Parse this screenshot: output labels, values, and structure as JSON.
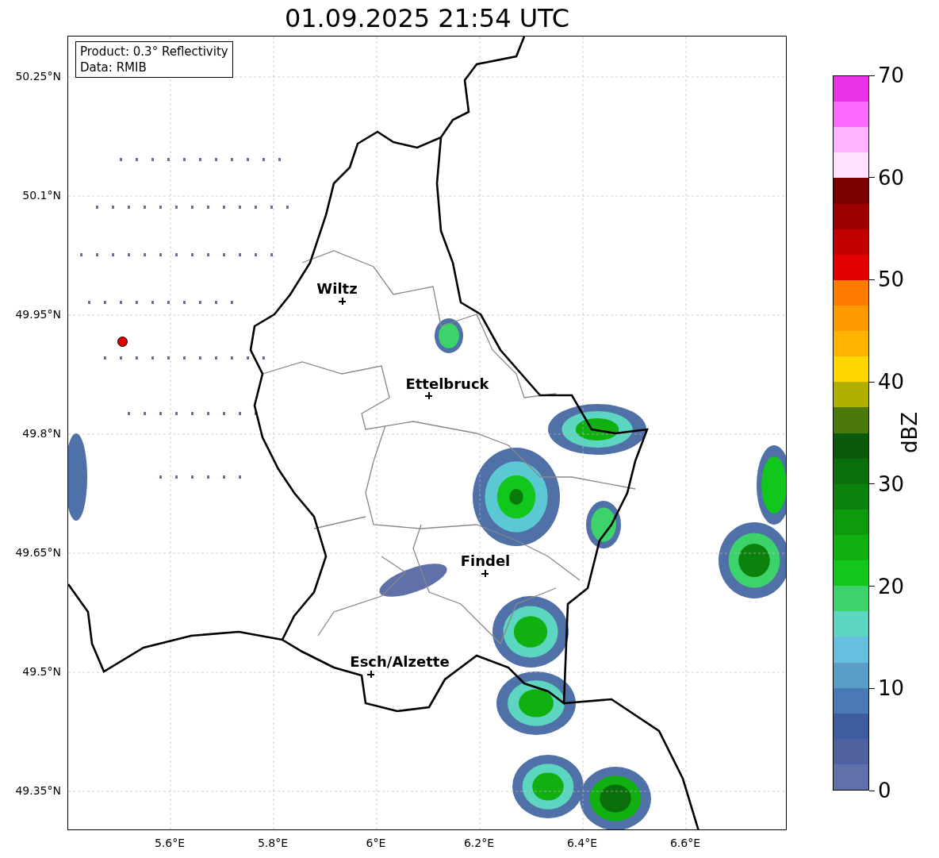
{
  "title": "01.09.2025 21:54 UTC",
  "info_box": [
    "Product: 0.3° Reflectivity",
    "Data: RMIB"
  ],
  "map": {
    "yticks": [
      "50.25°N",
      "50.1°N",
      "49.95°N",
      "49.8°N",
      "49.65°N",
      "49.5°N",
      "49.35°N"
    ],
    "xticks": [
      "5.6°E",
      "5.8°E",
      "6°E",
      "6.2°E",
      "6.4°E",
      "6.6°E"
    ],
    "cities": [
      {
        "name": "Wiltz"
      },
      {
        "name": "Ettelbruck"
      },
      {
        "name": "Findel"
      },
      {
        "name": "Esch/Alzette"
      }
    ]
  },
  "colorbar": {
    "label": "dBZ",
    "ticks": [
      "70",
      "60",
      "50",
      "40",
      "30",
      "20",
      "10",
      "0"
    ],
    "segments": [
      {
        "color": "#6070a8"
      },
      {
        "color": "#4e62a0"
      },
      {
        "color": "#3e5ca0"
      },
      {
        "color": "#4a7ab4"
      },
      {
        "color": "#5a9ec8"
      },
      {
        "color": "#64c0dc"
      },
      {
        "color": "#5cd6c0"
      },
      {
        "color": "#3cd46a"
      },
      {
        "color": "#12c71b"
      },
      {
        "color": "#10b010"
      },
      {
        "color": "#0d9a0d"
      },
      {
        "color": "#0b820b"
      },
      {
        "color": "#0a6e0a"
      },
      {
        "color": "#0a5a0a"
      },
      {
        "color": "#4a7a0a"
      },
      {
        "color": "#b0b000"
      },
      {
        "color": "#ffd600"
      },
      {
        "color": "#ffb200"
      },
      {
        "color": "#ff9900"
      },
      {
        "color": "#ff7a00"
      },
      {
        "color": "#e50000"
      },
      {
        "color": "#c20000"
      },
      {
        "color": "#9e0000"
      },
      {
        "color": "#7a0000"
      },
      {
        "color": "#ffe0fe"
      },
      {
        "color": "#feb3fe"
      },
      {
        "color": "#fe6afe"
      },
      {
        "color": "#e933e9"
      }
    ]
  }
}
